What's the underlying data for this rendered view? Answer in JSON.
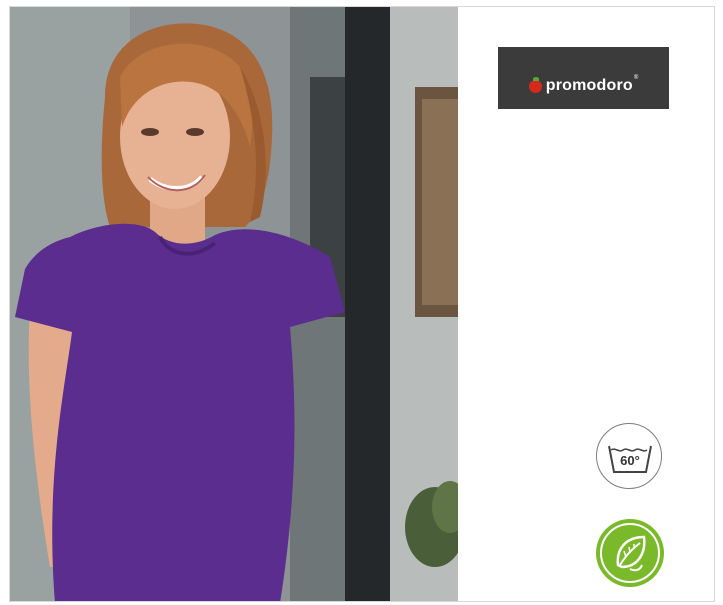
{
  "brand": {
    "name": "promodoro",
    "registered_mark": "®",
    "logo_bg": "#3b3b3b",
    "tomato_color": "#d42a1c"
  },
  "product_photo": {
    "subject": "woman-in-purple-tshirt",
    "shirt_color": "#5b2d8e"
  },
  "care": {
    "wash_temperature": "60°",
    "wash_icon": "wash-60-icon",
    "eco_icon": "eco-leaf-icon",
    "eco_color": "#7ab929"
  }
}
